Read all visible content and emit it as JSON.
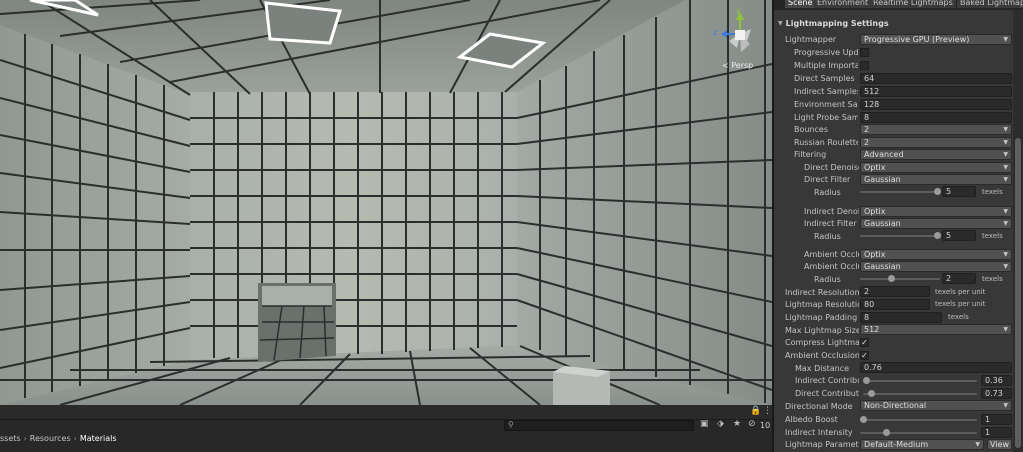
{
  "scene": {
    "gizmo_y": "y",
    "gizmo_z": "z",
    "projection": "< Persp"
  },
  "toolbar": {
    "lock_icon": "lock-icon",
    "menu_icon": "kebab-menu-icon",
    "search_placeholder": "",
    "search_icon": "search-icon",
    "hidden_count": "10"
  },
  "breadcrumb": {
    "part1": "ssets",
    "part2": "Resources",
    "part3": "Materials"
  },
  "tabs": [
    "Scene",
    "Environment",
    "Realtime Lightmaps",
    "Baked Lightmaps"
  ],
  "lightmapping": {
    "header": "Lightmapping Settings",
    "lightmapper_label": "Lightmapper",
    "lightmapper_value": "Progressive GPU (Preview)",
    "progressive_updates_label": "Progressive Upda",
    "multiple_importance_label": "Multiple Importanc",
    "direct_samples_label": "Direct Samples",
    "direct_samples_value": "64",
    "indirect_samples_label": "Indirect Samples",
    "indirect_samples_value": "512",
    "environment_samples_label": "Environment Samp",
    "environment_samples_value": "128",
    "light_probe_samples_label": "Light Probe Samp",
    "light_probe_samples_value": "8",
    "bounces_label": "Bounces",
    "bounces_value": "2",
    "russian_roulette_label": "Russian Roulette S",
    "russian_roulette_value": "2",
    "filtering_label": "Filtering",
    "filtering_value": "Advanced",
    "direct_denoiser_label": "Direct Denoiser",
    "direct_denoiser_value": "Optix",
    "direct_filter_label": "Direct Filter",
    "direct_filter_value": "Gaussian",
    "direct_radius_label": "Radius",
    "direct_radius_value": "5",
    "direct_radius_unit": "texels",
    "indirect_denoiser_label": "Indirect Denois",
    "indirect_denoiser_value": "Optix",
    "indirect_filter_label": "Indirect Filter",
    "indirect_filter_value": "Gaussian",
    "indirect_radius_label": "Radius",
    "indirect_radius_value": "5",
    "indirect_radius_unit": "texels",
    "ao_denoiser_label": "Ambient Occlus",
    "ao_denoiser_value": "Optix",
    "ao_filter_label": "Ambient Occlus",
    "ao_filter_value": "Gaussian",
    "ao_radius_label": "Radius",
    "ao_radius_value": "2",
    "ao_radius_unit": "texels",
    "indirect_resolution_label": "Indirect Resolution",
    "indirect_resolution_value": "2",
    "indirect_resolution_unit": "texels per unit",
    "lightmap_resolution_label": "Lightmap Resolution",
    "lightmap_resolution_value": "80",
    "lightmap_resolution_unit": "texels per unit",
    "lightmap_padding_label": "Lightmap Padding",
    "lightmap_padding_value": "8",
    "lightmap_padding_unit": "texels",
    "max_lightmap_size_label": "Max Lightmap Size",
    "max_lightmap_size_value": "512",
    "compress_lightmaps_label": "Compress Lightmaps",
    "ambient_occlusion_label": "Ambient Occlusion",
    "max_distance_label": "Max Distance",
    "max_distance_value": "0.76",
    "indirect_contribution_label": "Indirect Contributi",
    "indirect_contribution_value": "0.36",
    "direct_contribution_label": "Direct Contributio",
    "direct_contribution_value": "0.73",
    "directional_mode_label": "Directional Mode",
    "directional_mode_value": "Non-Directional",
    "albedo_boost_label": "Albedo Boost",
    "albedo_boost_value": "1",
    "indirect_intensity_label": "Indirect Intensity",
    "indirect_intensity_value": "1",
    "lightmap_parameters_label": "Lightmap Parameter",
    "lightmap_parameters_value": "Default-Medium",
    "view_button": "View",
    "check_mark": "✓",
    "dropdown_caret": "▼"
  },
  "colors": {
    "panel_bg": "#383838",
    "field_bg": "#2a2a2a",
    "dropdown_bg": "#515151",
    "tile_grout": "#2b2e2c",
    "gizmo_y": "#8fc43a",
    "gizmo_z": "#3c7ddb"
  }
}
